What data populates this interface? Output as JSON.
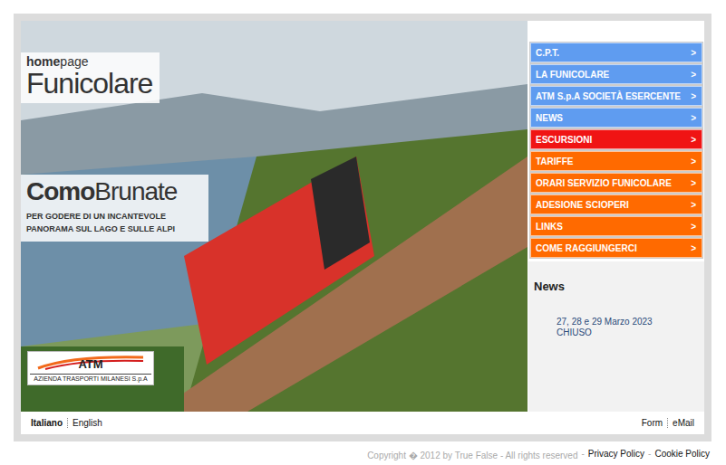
{
  "header": {
    "small_bold": "home",
    "small_light": "page",
    "title": "Funicolare"
  },
  "brand": {
    "bold": "Como",
    "light": "Brunate",
    "tagline": "PER GODERE DI UN INCANTEVOLE PANORAMA SUL LAGO E SULLE ALPI"
  },
  "logo": {
    "name": "ATM",
    "subtitle": "AZIENDA TRASPORTI MILANESI S.p.A"
  },
  "menu": {
    "arrow": ">",
    "items": [
      {
        "label": "C.P.T.",
        "color": "#5f9cf0"
      },
      {
        "label": "LA FUNICOLARE",
        "color": "#5f9cf0"
      },
      {
        "label": "ATM S.p.A SOCIETÀ ESERCENTE",
        "color": "#5f9cf0"
      },
      {
        "label": "NEWS",
        "color": "#5f9cf0"
      },
      {
        "label": "ESCURSIONI",
        "color": "#f01414"
      },
      {
        "label": "TARIFFE",
        "color": "#ff6a00"
      },
      {
        "label": "ORARI SERVIZIO FUNICOLARE",
        "color": "#ff6a00"
      },
      {
        "label": "ADESIONE SCIOPERI",
        "color": "#ff6a00"
      },
      {
        "label": "LINKS",
        "color": "#ff6a00"
      },
      {
        "label": "COME RAGGIUNGERCI",
        "color": "#ff6a00"
      }
    ]
  },
  "news": {
    "title": "News",
    "items": [
      {
        "date": "27, 28 e 29 Marzo 2023",
        "text": "CHIUSO"
      }
    ]
  },
  "languages": [
    {
      "label": "Italiano",
      "selected": true
    },
    {
      "label": "English",
      "selected": false
    }
  ],
  "links": [
    "Form",
    "eMail"
  ],
  "footer": {
    "copyright": "Copyright � 2012 by True False - All rights reserved",
    "separator": "-",
    "links": [
      "Privacy Policy",
      "Cookie Policy"
    ]
  }
}
